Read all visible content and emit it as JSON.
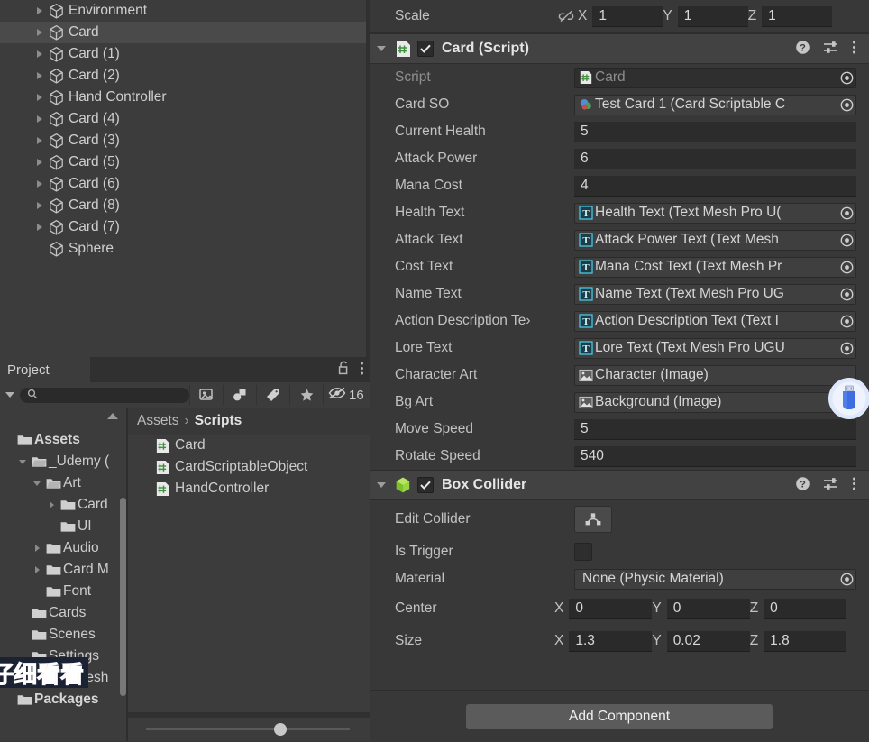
{
  "hierarchy": {
    "items": [
      {
        "label": "Environment",
        "arrow": true,
        "selected": false
      },
      {
        "label": "Card",
        "arrow": true,
        "selected": true
      },
      {
        "label": "Card (1)",
        "arrow": true,
        "selected": false
      },
      {
        "label": "Card (2)",
        "arrow": true,
        "selected": false
      },
      {
        "label": "Hand Controller",
        "arrow": true,
        "selected": false
      },
      {
        "label": "Card (4)",
        "arrow": true,
        "selected": false
      },
      {
        "label": "Card (3)",
        "arrow": true,
        "selected": false
      },
      {
        "label": "Card (5)",
        "arrow": true,
        "selected": false
      },
      {
        "label": "Card (6)",
        "arrow": true,
        "selected": false
      },
      {
        "label": "Card (8)",
        "arrow": true,
        "selected": false
      },
      {
        "label": "Card (7)",
        "arrow": true,
        "selected": false
      },
      {
        "label": "Sphere",
        "arrow": false,
        "selected": false
      }
    ]
  },
  "project": {
    "tab_label": "Project",
    "search_value": "",
    "hidden_count": "16",
    "breadcrumb": {
      "root": "Assets",
      "sep": "›",
      "current": "Scripts"
    },
    "tree": [
      {
        "label": "Assets",
        "depth": 0,
        "arrow": "none",
        "bold": true
      },
      {
        "label": "_Udemy (",
        "depth": 1,
        "arrow": "down",
        "bold": false
      },
      {
        "label": "Art",
        "depth": 2,
        "arrow": "down",
        "bold": false
      },
      {
        "label": "Card",
        "depth": 3,
        "arrow": "right",
        "bold": false
      },
      {
        "label": "UI",
        "depth": 3,
        "arrow": "none",
        "bold": false
      },
      {
        "label": "Audio",
        "depth": 2,
        "arrow": "right",
        "bold": false
      },
      {
        "label": "Card M",
        "depth": 2,
        "arrow": "right",
        "bold": false
      },
      {
        "label": "Font",
        "depth": 2,
        "arrow": "none",
        "bold": false
      },
      {
        "label": "Cards",
        "depth": 1,
        "arrow": "none",
        "bold": false
      },
      {
        "label": "Scenes",
        "depth": 1,
        "arrow": "none",
        "bold": false
      },
      {
        "label": "Settings",
        "depth": 1,
        "arrow": "none",
        "bold": false
      },
      {
        "label": "TextMesh",
        "depth": 1,
        "arrow": "right",
        "bold": false
      },
      {
        "label": "Packages",
        "depth": 0,
        "arrow": "none",
        "bold": true
      }
    ],
    "files": [
      {
        "label": "Card"
      },
      {
        "label": "CardScriptableObject"
      },
      {
        "label": "HandController"
      }
    ]
  },
  "overlay": {
    "subtitle_text": "仔细看看"
  },
  "inspector": {
    "scale": {
      "label": "Scale",
      "axes": [
        {
          "axis": "X",
          "value": "1"
        },
        {
          "axis": "Y",
          "value": "1"
        },
        {
          "axis": "Z",
          "value": "1"
        }
      ]
    },
    "card_script": {
      "title": "Card (Script)",
      "enabled": true,
      "rows": [
        {
          "label": "Script",
          "type": "objref",
          "value": "Card",
          "icon": "script-file-icon",
          "dim": true,
          "picker": true
        },
        {
          "label": "Card SO",
          "type": "objref",
          "value": "Test Card 1 (Card Scriptable C",
          "icon": "scriptable-object-icon",
          "dim": false,
          "picker": true
        },
        {
          "label": "Current Health",
          "type": "number",
          "value": "5"
        },
        {
          "label": "Attack Power",
          "type": "number",
          "value": "6"
        },
        {
          "label": "Mana Cost",
          "type": "number",
          "value": "4"
        },
        {
          "label": "Health Text",
          "type": "objref",
          "value": "Health Text (Text Mesh Pro U(",
          "icon": "tmp-text-icon",
          "dim": false,
          "picker": true
        },
        {
          "label": "Attack Text",
          "type": "objref",
          "value": "Attack Power Text (Text Mesh",
          "icon": "tmp-text-icon",
          "dim": false,
          "picker": true
        },
        {
          "label": "Cost Text",
          "type": "objref",
          "value": "Mana Cost Text (Text Mesh Pr",
          "icon": "tmp-text-icon",
          "dim": false,
          "picker": true
        },
        {
          "label": "Name Text",
          "type": "objref",
          "value": "Name Text (Text Mesh Pro UG",
          "icon": "tmp-text-icon",
          "dim": false,
          "picker": true
        },
        {
          "label": "Action Description Te›",
          "type": "objref",
          "value": "Action Description Text (Text I",
          "icon": "tmp-text-icon",
          "dim": false,
          "picker": true
        },
        {
          "label": "Lore Text",
          "type": "objref",
          "value": "Lore Text (Text Mesh Pro UGU",
          "icon": "tmp-text-icon",
          "dim": false,
          "picker": true
        },
        {
          "label": "Character Art",
          "type": "objref",
          "value": "Character (Image)",
          "icon": "image-component-icon",
          "dim": false,
          "picker": false
        },
        {
          "label": "Bg Art",
          "type": "objref",
          "value": "Background (Image)",
          "icon": "image-component-icon",
          "dim": false,
          "picker": false
        },
        {
          "label": "Move Speed",
          "type": "number",
          "value": "5"
        },
        {
          "label": "Rotate Speed",
          "type": "number",
          "value": "540"
        }
      ]
    },
    "box_collider": {
      "title": "Box Collider",
      "enabled": true,
      "edit_collider_label": "Edit Collider",
      "is_trigger_label": "Is Trigger",
      "is_trigger_checked": false,
      "material_label": "Material",
      "material_value": "None (Physic Material)",
      "center": {
        "label": "Center",
        "axes": [
          {
            "axis": "X",
            "value": "0"
          },
          {
            "axis": "Y",
            "value": "0"
          },
          {
            "axis": "Z",
            "value": "0"
          }
        ]
      },
      "size": {
        "label": "Size",
        "axes": [
          {
            "axis": "X",
            "value": "1.3"
          },
          {
            "axis": "Y",
            "value": "0.02"
          },
          {
            "axis": "Z",
            "value": "1.8"
          }
        ]
      }
    },
    "add_component_label": "Add Component"
  },
  "colors": {
    "panel_bg": "#3c3c3c",
    "inspector_bg": "#383838",
    "header_bg": "#424242",
    "selection": "#4a4a4a",
    "field_bg": "#2c2c2c",
    "text": "#c4c4c4",
    "subtitle_red": "#e8221f",
    "usb_blue": "#3d6fe0",
    "script_green": "#4c9a4c"
  }
}
